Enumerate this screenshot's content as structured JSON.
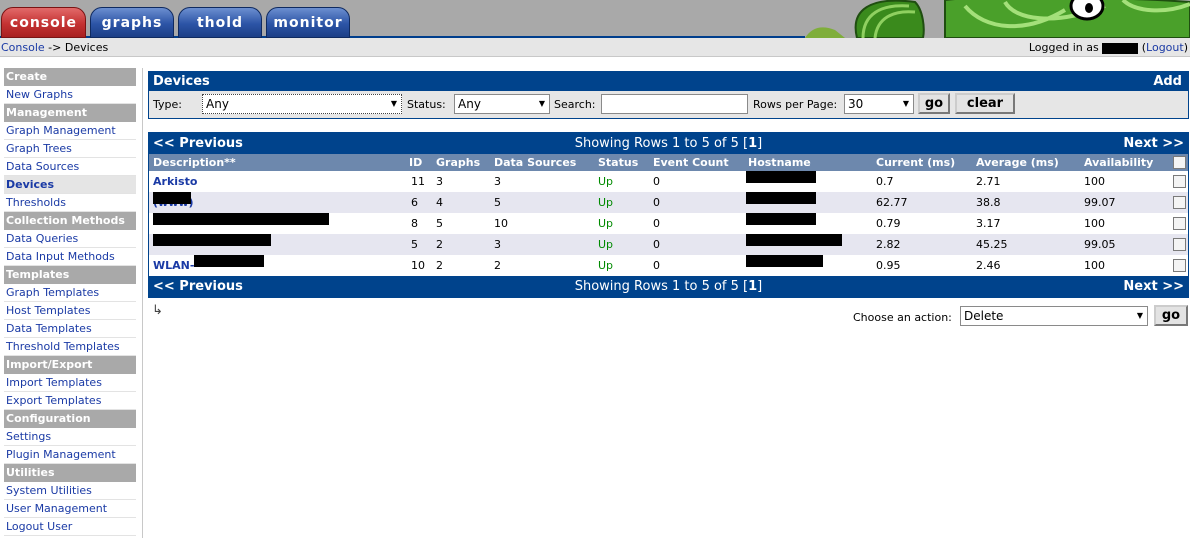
{
  "tabs": [
    {
      "label": "console",
      "active": true
    },
    {
      "label": "graphs",
      "active": false
    },
    {
      "label": "thold",
      "active": false
    },
    {
      "label": "monitor",
      "active": false
    }
  ],
  "breadcrumb": {
    "console": "Console",
    "separator": "->",
    "current": "Devices"
  },
  "login": {
    "prefix": "Logged in as",
    "logout": "Logout"
  },
  "sidebar": [
    {
      "type": "header",
      "label": "Create"
    },
    {
      "type": "item",
      "label": "New Graphs"
    },
    {
      "type": "header",
      "label": "Management"
    },
    {
      "type": "item",
      "label": "Graph Management"
    },
    {
      "type": "item",
      "label": "Graph Trees"
    },
    {
      "type": "item",
      "label": "Data Sources"
    },
    {
      "type": "item",
      "label": "Devices",
      "selected": true
    },
    {
      "type": "item",
      "label": "Thresholds"
    },
    {
      "type": "header",
      "label": "Collection Methods"
    },
    {
      "type": "item",
      "label": "Data Queries"
    },
    {
      "type": "item",
      "label": "Data Input Methods"
    },
    {
      "type": "header",
      "label": "Templates"
    },
    {
      "type": "item",
      "label": "Graph Templates"
    },
    {
      "type": "item",
      "label": "Host Templates"
    },
    {
      "type": "item",
      "label": "Data Templates"
    },
    {
      "type": "item",
      "label": "Threshold Templates"
    },
    {
      "type": "header",
      "label": "Import/Export"
    },
    {
      "type": "item",
      "label": "Import Templates"
    },
    {
      "type": "item",
      "label": "Export Templates"
    },
    {
      "type": "header",
      "label": "Configuration"
    },
    {
      "type": "item",
      "label": "Settings"
    },
    {
      "type": "item",
      "label": "Plugin Management"
    },
    {
      "type": "header",
      "label": "Utilities"
    },
    {
      "type": "item",
      "label": "System Utilities"
    },
    {
      "type": "item",
      "label": "User Management"
    },
    {
      "type": "item",
      "label": "Logout User"
    }
  ],
  "filter": {
    "title": "Devices",
    "add_label": "Add",
    "type_label": "Type:",
    "type_value": "Any",
    "status_label": "Status:",
    "status_value": "Any",
    "search_label": "Search:",
    "search_value": "",
    "rows_label": "Rows per Page:",
    "rows_value": "30",
    "go_label": "go",
    "clear_label": "clear"
  },
  "nav": {
    "prev": "<< Previous",
    "showing": "Showing Rows 1 to 5 of 5 [",
    "page": "1",
    "showing_end": "]",
    "next": "Next >>"
  },
  "columns": {
    "description": "Description**",
    "id": "ID",
    "graphs": "Graphs",
    "data_sources": "Data Sources",
    "status": "Status",
    "event_count": "Event Count",
    "hostname": "Hostname",
    "current": "Current (ms)",
    "average": "Average (ms)",
    "availability": "Availability"
  },
  "rows": [
    {
      "description": "Arkisto",
      "id": "11",
      "graphs": "3",
      "data_sources": "3",
      "status": "Up",
      "event_count": "0",
      "current": "0.7",
      "average": "2.71",
      "availability": "100"
    },
    {
      "description": "(www)",
      "id": "6",
      "graphs": "4",
      "data_sources": "5",
      "status": "Up",
      "event_count": "0",
      "current": "62.77",
      "average": "38.8",
      "availability": "99.07"
    },
    {
      "description": "",
      "id": "8",
      "graphs": "5",
      "data_sources": "10",
      "status": "Up",
      "event_count": "0",
      "current": "0.79",
      "average": "3.17",
      "availability": "100"
    },
    {
      "description": "",
      "id": "5",
      "graphs": "2",
      "data_sources": "3",
      "status": "Up",
      "event_count": "0",
      "current": "2.82",
      "average": "45.25",
      "availability": "99.05"
    },
    {
      "description": "WLAN-",
      "id": "10",
      "graphs": "2",
      "data_sources": "2",
      "status": "Up",
      "event_count": "0",
      "current": "0.95",
      "average": "2.46",
      "availability": "100"
    }
  ],
  "actions": {
    "label": "Choose an action:",
    "value": "Delete",
    "go_label": "go"
  },
  "colors": {
    "header_blue": "#00438c",
    "column_header": "#6d88ad",
    "sidebar_header": "#a9a9a9",
    "status_up": "#008a00",
    "link": "#1a3aa5"
  }
}
